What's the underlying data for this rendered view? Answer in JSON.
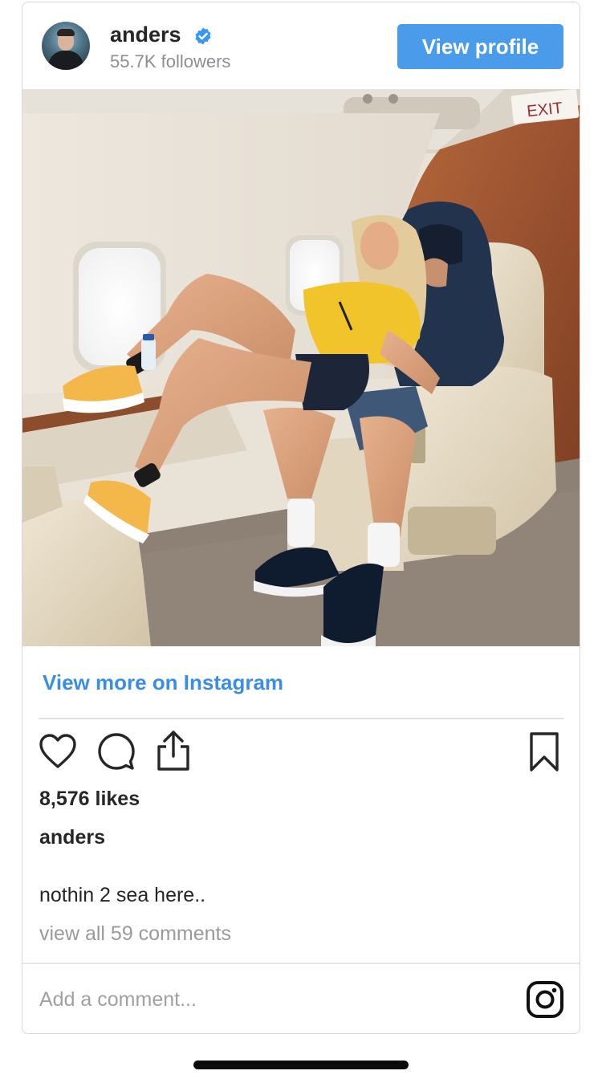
{
  "header": {
    "username": "anders",
    "followers": "55.7K followers",
    "view_profile_label": "View profile",
    "verified_icon": "verified-badge-icon",
    "accent_color": "#4a9be9"
  },
  "post": {
    "photo_sign_text": "EXIT",
    "view_more_label": "View more on Instagram",
    "likes": "8,576 likes",
    "caption_user": "anders",
    "caption_text": "nothin 2 sea here..",
    "view_comments_label": "view all 59 comments",
    "comment_placeholder": "Add a comment...",
    "actions": [
      "heart-icon",
      "comment-icon",
      "share-icon",
      "bookmark-icon"
    ],
    "footer_icon": "instagram-icon"
  }
}
